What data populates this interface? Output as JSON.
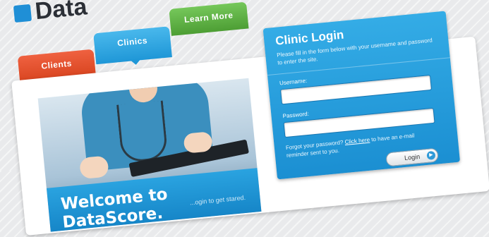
{
  "logo": {
    "text": "Data"
  },
  "tabs": [
    {
      "label": "Clients",
      "color": "#e2512a"
    },
    {
      "label": "Clinics",
      "color": "#2ea7e3"
    },
    {
      "label": "Learn More",
      "color": "#5cae3f"
    }
  ],
  "hero": {
    "title": "Welcome to DataScore.",
    "subtitle": "...ogin to get stared."
  },
  "login": {
    "title": "Clinic Login",
    "description": "Please fill in the form below with your username and password to enter the site.",
    "username_label": "Username:",
    "password_label": "Password:",
    "forgot_before": "Forgot your password? ",
    "forgot_link": "Click here",
    "forgot_after": " to have an e-mail reminder sent to you.",
    "button_label": "Login"
  }
}
